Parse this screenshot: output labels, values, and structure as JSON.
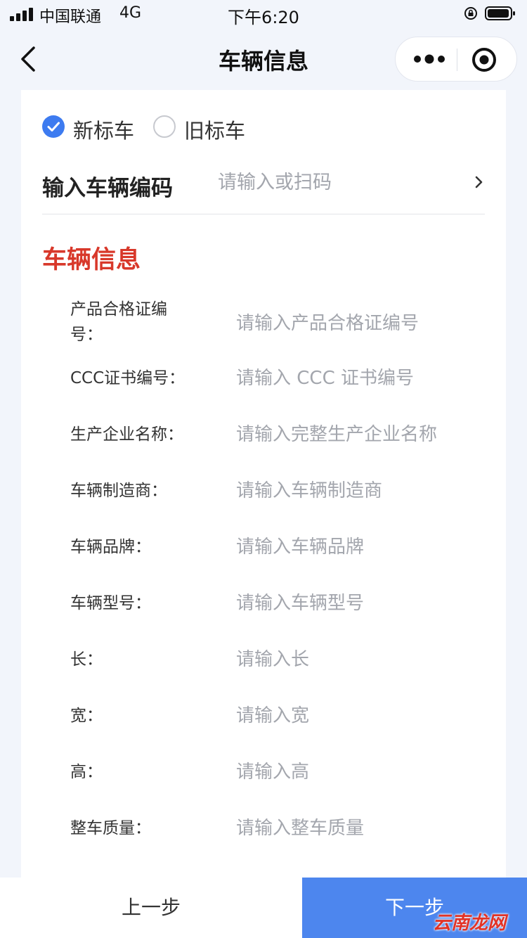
{
  "status_bar": {
    "carrier": "中国联通",
    "network": "4G",
    "time": "下午6:20"
  },
  "nav": {
    "title": "车辆信息",
    "back_icon": "chevron-left-icon",
    "more_icon": "more-dots-icon",
    "close_icon": "target-close-icon"
  },
  "plate_type": {
    "options": [
      {
        "label": "新标车",
        "checked": true
      },
      {
        "label": "旧标车",
        "checked": false
      }
    ]
  },
  "vehicle_code": {
    "label": "输入车辆编码",
    "placeholder": "请输入或扫码",
    "value": ""
  },
  "section": {
    "title": "车辆信息"
  },
  "fields": [
    {
      "label": "产品合格证编号：",
      "placeholder": "请输入产品合格证编号",
      "value": ""
    },
    {
      "label": "CCC证书编号：",
      "placeholder": "请输入 CCC 证书编号",
      "value": ""
    },
    {
      "label": "生产企业名称：",
      "placeholder": "请输入完整生产企业名称",
      "value": ""
    },
    {
      "label": "车辆制造商：",
      "placeholder": "请输入车辆制造商",
      "value": ""
    },
    {
      "label": "车辆品牌：",
      "placeholder": "请输入车辆品牌",
      "value": ""
    },
    {
      "label": "车辆型号：",
      "placeholder": "请输入车辆型号",
      "value": ""
    },
    {
      "label": "长：",
      "placeholder": "请输入长",
      "value": ""
    },
    {
      "label": "宽：",
      "placeholder": "请输入宽",
      "value": ""
    },
    {
      "label": "高：",
      "placeholder": "请输入高",
      "value": ""
    },
    {
      "label": "整车质量：",
      "placeholder": "请输入整车质量",
      "value": ""
    }
  ],
  "footer": {
    "prev_label": "上一步",
    "next_label": "下一步",
    "watermark": "云南龙网"
  },
  "colors": {
    "accent": "#3d7bf0",
    "next_button": "#4d86ee",
    "section_title": "#d8382a",
    "placeholder": "#a3a6ad",
    "background": "#f2f5fb"
  }
}
